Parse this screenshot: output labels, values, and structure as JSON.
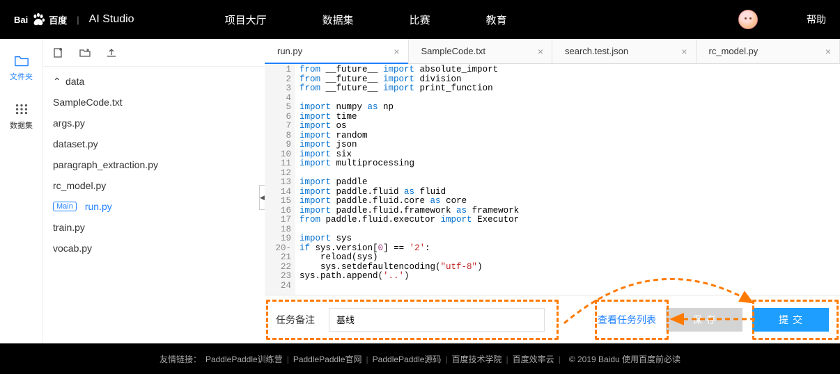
{
  "header": {
    "logo_text": "百度",
    "logo_suffix": "AI Studio",
    "nav": [
      "项目大厅",
      "数据集",
      "比赛",
      "教育"
    ],
    "help": "帮助"
  },
  "rail": {
    "files": "文件夹",
    "datasets": "数据集"
  },
  "tree": {
    "folder": "data",
    "files": [
      "SampleCode.txt",
      "args.py",
      "dataset.py",
      "paragraph_extraction.py",
      "rc_model.py"
    ],
    "main_file": "run.py",
    "main_badge": "Main",
    "files2": [
      "train.py",
      "vocab.py"
    ]
  },
  "tabs": [
    {
      "name": "run.py",
      "active": true
    },
    {
      "name": "SampleCode.txt",
      "active": false
    },
    {
      "name": "search.test.json",
      "active": false
    },
    {
      "name": "rc_model.py",
      "active": false
    }
  ],
  "code_lines": [
    [
      [
        "kw-blue",
        "from"
      ],
      [
        "kw-name",
        " __future__ "
      ],
      [
        "kw-blue",
        "import"
      ],
      [
        "kw-name",
        " absolute_import"
      ]
    ],
    [
      [
        "kw-blue",
        "from"
      ],
      [
        "kw-name",
        " __future__ "
      ],
      [
        "kw-blue",
        "import"
      ],
      [
        "kw-name",
        " division"
      ]
    ],
    [
      [
        "kw-blue",
        "from"
      ],
      [
        "kw-name",
        " __future__ "
      ],
      [
        "kw-blue",
        "import"
      ],
      [
        "kw-name",
        " print_function"
      ]
    ],
    [],
    [
      [
        "kw-blue",
        "import"
      ],
      [
        "kw-name",
        " numpy "
      ],
      [
        "kw-blue",
        "as"
      ],
      [
        "kw-name",
        " np"
      ]
    ],
    [
      [
        "kw-blue",
        "import"
      ],
      [
        "kw-name",
        " time"
      ]
    ],
    [
      [
        "kw-blue",
        "import"
      ],
      [
        "kw-name",
        " os"
      ]
    ],
    [
      [
        "kw-blue",
        "import"
      ],
      [
        "kw-name",
        " random"
      ]
    ],
    [
      [
        "kw-blue",
        "import"
      ],
      [
        "kw-name",
        " json"
      ]
    ],
    [
      [
        "kw-blue",
        "import"
      ],
      [
        "kw-name",
        " six"
      ]
    ],
    [
      [
        "kw-blue",
        "import"
      ],
      [
        "kw-name",
        " multiprocessing"
      ]
    ],
    [],
    [
      [
        "kw-blue",
        "import"
      ],
      [
        "kw-name",
        " paddle"
      ]
    ],
    [
      [
        "kw-blue",
        "import"
      ],
      [
        "kw-name",
        " paddle.fluid "
      ],
      [
        "kw-blue",
        "as"
      ],
      [
        "kw-name",
        " fluid"
      ]
    ],
    [
      [
        "kw-blue",
        "import"
      ],
      [
        "kw-name",
        " paddle.fluid.core "
      ],
      [
        "kw-blue",
        "as"
      ],
      [
        "kw-name",
        " core"
      ]
    ],
    [
      [
        "kw-blue",
        "import"
      ],
      [
        "kw-name",
        " paddle.fluid.framework "
      ],
      [
        "kw-blue",
        "as"
      ],
      [
        "kw-name",
        " framework"
      ]
    ],
    [
      [
        "kw-blue",
        "from"
      ],
      [
        "kw-name",
        " paddle.fluid.executor "
      ],
      [
        "kw-blue",
        "import"
      ],
      [
        "kw-name",
        " Executor"
      ]
    ],
    [],
    [
      [
        "kw-blue",
        "import"
      ],
      [
        "kw-name",
        " sys"
      ]
    ],
    [
      [
        "kw-blue",
        "if"
      ],
      [
        "kw-name",
        " sys.version["
      ],
      [
        "kw-num",
        "0"
      ],
      [
        "kw-name",
        "] == "
      ],
      [
        "kw-str",
        "'2'"
      ],
      [
        "kw-name",
        ":"
      ]
    ],
    [
      [
        "kw-name",
        "    reload(sys)"
      ]
    ],
    [
      [
        "kw-name",
        "    sys.setdefaultencoding("
      ],
      [
        "kw-str",
        "\"utf-8\""
      ],
      [
        "kw-name",
        ")"
      ]
    ],
    [
      [
        "kw-name",
        "sys.path.append("
      ],
      [
        "kw-str",
        "'..'"
      ],
      [
        "kw-name",
        ")"
      ]
    ],
    []
  ],
  "line_markers": {
    "20": "-"
  },
  "bottom": {
    "remark_label": "任务备注",
    "remark_value": "基线",
    "view_tasks": "查看任务列表",
    "save": "保存",
    "submit": "提交"
  },
  "footer": {
    "prefix": "友情链接：",
    "links": [
      "PaddlePaddle训练营",
      "PaddlePaddle官网",
      "PaddlePaddle源码",
      "百度技术学院",
      "百度效率云"
    ],
    "copyright": "© 2019 Baidu 使用百度前必读"
  }
}
